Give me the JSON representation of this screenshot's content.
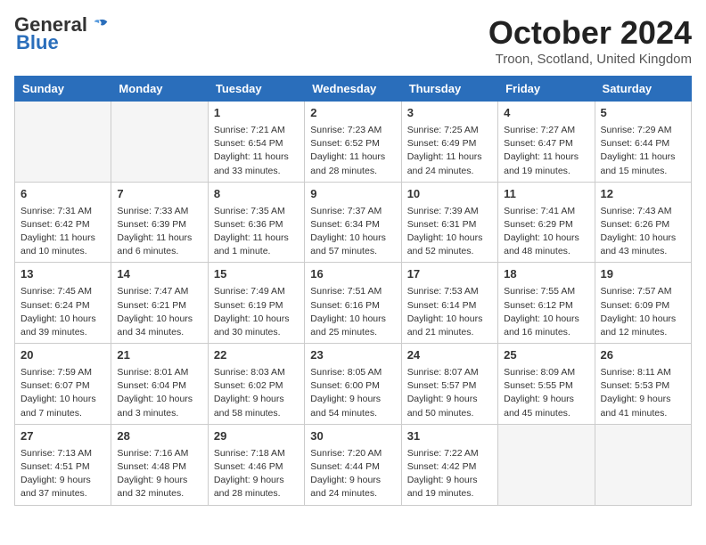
{
  "header": {
    "logo_general": "General",
    "logo_blue": "Blue",
    "month_title": "October 2024",
    "location": "Troon, Scotland, United Kingdom"
  },
  "days_of_week": [
    "Sunday",
    "Monday",
    "Tuesday",
    "Wednesday",
    "Thursday",
    "Friday",
    "Saturday"
  ],
  "weeks": [
    [
      {
        "day": "",
        "sunrise": "",
        "sunset": "",
        "daylight": "",
        "empty": true
      },
      {
        "day": "",
        "sunrise": "",
        "sunset": "",
        "daylight": "",
        "empty": true
      },
      {
        "day": "1",
        "sunrise": "Sunrise: 7:21 AM",
        "sunset": "Sunset: 6:54 PM",
        "daylight": "Daylight: 11 hours and 33 minutes."
      },
      {
        "day": "2",
        "sunrise": "Sunrise: 7:23 AM",
        "sunset": "Sunset: 6:52 PM",
        "daylight": "Daylight: 11 hours and 28 minutes."
      },
      {
        "day": "3",
        "sunrise": "Sunrise: 7:25 AM",
        "sunset": "Sunset: 6:49 PM",
        "daylight": "Daylight: 11 hours and 24 minutes."
      },
      {
        "day": "4",
        "sunrise": "Sunrise: 7:27 AM",
        "sunset": "Sunset: 6:47 PM",
        "daylight": "Daylight: 11 hours and 19 minutes."
      },
      {
        "day": "5",
        "sunrise": "Sunrise: 7:29 AM",
        "sunset": "Sunset: 6:44 PM",
        "daylight": "Daylight: 11 hours and 15 minutes."
      }
    ],
    [
      {
        "day": "6",
        "sunrise": "Sunrise: 7:31 AM",
        "sunset": "Sunset: 6:42 PM",
        "daylight": "Daylight: 11 hours and 10 minutes."
      },
      {
        "day": "7",
        "sunrise": "Sunrise: 7:33 AM",
        "sunset": "Sunset: 6:39 PM",
        "daylight": "Daylight: 11 hours and 6 minutes."
      },
      {
        "day": "8",
        "sunrise": "Sunrise: 7:35 AM",
        "sunset": "Sunset: 6:36 PM",
        "daylight": "Daylight: 11 hours and 1 minute."
      },
      {
        "day": "9",
        "sunrise": "Sunrise: 7:37 AM",
        "sunset": "Sunset: 6:34 PM",
        "daylight": "Daylight: 10 hours and 57 minutes."
      },
      {
        "day": "10",
        "sunrise": "Sunrise: 7:39 AM",
        "sunset": "Sunset: 6:31 PM",
        "daylight": "Daylight: 10 hours and 52 minutes."
      },
      {
        "day": "11",
        "sunrise": "Sunrise: 7:41 AM",
        "sunset": "Sunset: 6:29 PM",
        "daylight": "Daylight: 10 hours and 48 minutes."
      },
      {
        "day": "12",
        "sunrise": "Sunrise: 7:43 AM",
        "sunset": "Sunset: 6:26 PM",
        "daylight": "Daylight: 10 hours and 43 minutes."
      }
    ],
    [
      {
        "day": "13",
        "sunrise": "Sunrise: 7:45 AM",
        "sunset": "Sunset: 6:24 PM",
        "daylight": "Daylight: 10 hours and 39 minutes."
      },
      {
        "day": "14",
        "sunrise": "Sunrise: 7:47 AM",
        "sunset": "Sunset: 6:21 PM",
        "daylight": "Daylight: 10 hours and 34 minutes."
      },
      {
        "day": "15",
        "sunrise": "Sunrise: 7:49 AM",
        "sunset": "Sunset: 6:19 PM",
        "daylight": "Daylight: 10 hours and 30 minutes."
      },
      {
        "day": "16",
        "sunrise": "Sunrise: 7:51 AM",
        "sunset": "Sunset: 6:16 PM",
        "daylight": "Daylight: 10 hours and 25 minutes."
      },
      {
        "day": "17",
        "sunrise": "Sunrise: 7:53 AM",
        "sunset": "Sunset: 6:14 PM",
        "daylight": "Daylight: 10 hours and 21 minutes."
      },
      {
        "day": "18",
        "sunrise": "Sunrise: 7:55 AM",
        "sunset": "Sunset: 6:12 PM",
        "daylight": "Daylight: 10 hours and 16 minutes."
      },
      {
        "day": "19",
        "sunrise": "Sunrise: 7:57 AM",
        "sunset": "Sunset: 6:09 PM",
        "daylight": "Daylight: 10 hours and 12 minutes."
      }
    ],
    [
      {
        "day": "20",
        "sunrise": "Sunrise: 7:59 AM",
        "sunset": "Sunset: 6:07 PM",
        "daylight": "Daylight: 10 hours and 7 minutes."
      },
      {
        "day": "21",
        "sunrise": "Sunrise: 8:01 AM",
        "sunset": "Sunset: 6:04 PM",
        "daylight": "Daylight: 10 hours and 3 minutes."
      },
      {
        "day": "22",
        "sunrise": "Sunrise: 8:03 AM",
        "sunset": "Sunset: 6:02 PM",
        "daylight": "Daylight: 9 hours and 58 minutes."
      },
      {
        "day": "23",
        "sunrise": "Sunrise: 8:05 AM",
        "sunset": "Sunset: 6:00 PM",
        "daylight": "Daylight: 9 hours and 54 minutes."
      },
      {
        "day": "24",
        "sunrise": "Sunrise: 8:07 AM",
        "sunset": "Sunset: 5:57 PM",
        "daylight": "Daylight: 9 hours and 50 minutes."
      },
      {
        "day": "25",
        "sunrise": "Sunrise: 8:09 AM",
        "sunset": "Sunset: 5:55 PM",
        "daylight": "Daylight: 9 hours and 45 minutes."
      },
      {
        "day": "26",
        "sunrise": "Sunrise: 8:11 AM",
        "sunset": "Sunset: 5:53 PM",
        "daylight": "Daylight: 9 hours and 41 minutes."
      }
    ],
    [
      {
        "day": "27",
        "sunrise": "Sunrise: 7:13 AM",
        "sunset": "Sunset: 4:51 PM",
        "daylight": "Daylight: 9 hours and 37 minutes."
      },
      {
        "day": "28",
        "sunrise": "Sunrise: 7:16 AM",
        "sunset": "Sunset: 4:48 PM",
        "daylight": "Daylight: 9 hours and 32 minutes."
      },
      {
        "day": "29",
        "sunrise": "Sunrise: 7:18 AM",
        "sunset": "Sunset: 4:46 PM",
        "daylight": "Daylight: 9 hours and 28 minutes."
      },
      {
        "day": "30",
        "sunrise": "Sunrise: 7:20 AM",
        "sunset": "Sunset: 4:44 PM",
        "daylight": "Daylight: 9 hours and 24 minutes."
      },
      {
        "day": "31",
        "sunrise": "Sunrise: 7:22 AM",
        "sunset": "Sunset: 4:42 PM",
        "daylight": "Daylight: 9 hours and 19 minutes."
      },
      {
        "day": "",
        "sunrise": "",
        "sunset": "",
        "daylight": "",
        "empty": true
      },
      {
        "day": "",
        "sunrise": "",
        "sunset": "",
        "daylight": "",
        "empty": true
      }
    ]
  ]
}
